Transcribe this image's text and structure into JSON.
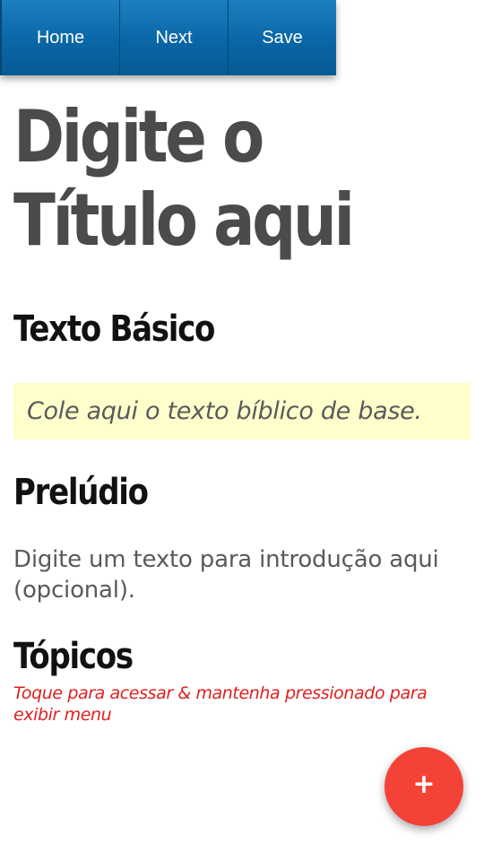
{
  "toolbar": {
    "home_label": "Home",
    "next_label": "Next",
    "save_label": "Save"
  },
  "title": "Digite o Título aqui",
  "sections": {
    "texto_basico": {
      "heading": "Texto Básico",
      "placeholder": "Cole aqui o texto bíblico de base."
    },
    "preludio": {
      "heading": "Prelúdio",
      "placeholder": "Digite um texto para introdução aqui (opcional)."
    },
    "topicos": {
      "heading": "Tópicos",
      "hint": "Toque para acessar & mantenha pressionado para exibir menu"
    }
  },
  "fab": {
    "icon": "plus-icon",
    "symbol": "+",
    "color": "#f44336"
  },
  "colors": {
    "toolbar": "#0a66a6",
    "base_text_bg": "#ffffcc",
    "hint": "#e01e1e",
    "title": "#4b4b4b"
  }
}
